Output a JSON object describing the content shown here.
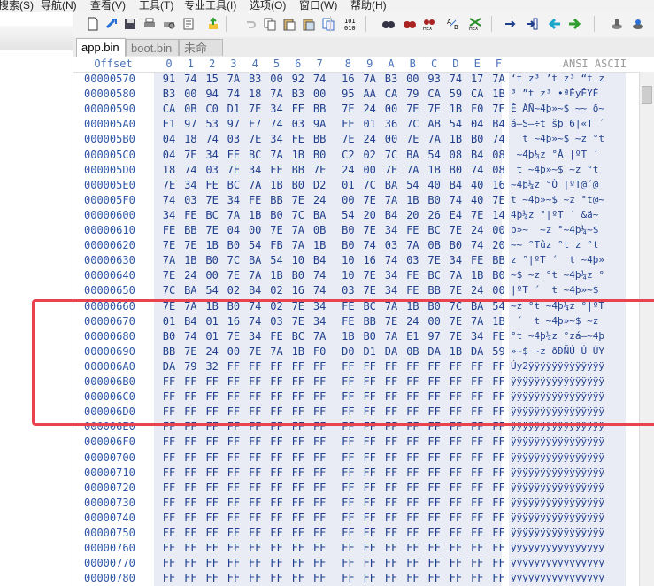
{
  "menu": [
    "搜索(S)",
    "导航(N)",
    "查看(V)",
    "工具(T)",
    "专业工具(I)",
    "选项(O)",
    "窗口(W)",
    "帮助(H)"
  ],
  "toolbar_icons": [
    "new-file-icon",
    "open-file-icon",
    "save-icon",
    "print-icon",
    "print-preview-icon",
    "properties-icon",
    "upload-icon",
    "undo-icon",
    "copy-icon",
    "paste-icon",
    "paste-special-icon",
    "copy-format-icon",
    "binary-icon",
    "find-icon",
    "find-next-icon",
    "find-hex-icon",
    "replace-icon",
    "replace-hex-icon",
    "goto-icon",
    "goto-offset-icon",
    "back-icon",
    "forward-icon",
    "tools-icon",
    "settings-icon"
  ],
  "tabs": [
    {
      "label": "app.bin",
      "active": true
    },
    {
      "label": "boot.bin",
      "active": false
    },
    {
      "label": "未命名",
      "active": false
    }
  ],
  "header": {
    "offset_label": "Offset",
    "columns": [
      "0",
      "1",
      "2",
      "3",
      "4",
      "5",
      "6",
      "7",
      "8",
      "9",
      "A",
      "B",
      "C",
      "D",
      "E",
      "F"
    ],
    "ansi_label": "ANSI ASCII"
  },
  "rows": [
    {
      "offset": "00000570",
      "bytes": [
        "91",
        "74",
        "15",
        "7A",
        "B3",
        "00",
        "92",
        "74",
        "16",
        "7A",
        "B3",
        "00",
        "93",
        "74",
        "17",
        "7A"
      ],
      "ansi": "‘t z³ ’t z³ “t z"
    },
    {
      "offset": "00000580",
      "bytes": [
        "B3",
        "00",
        "94",
        "74",
        "18",
        "7A",
        "B3",
        "00",
        "95",
        "AA",
        "CA",
        "79",
        "CA",
        "59",
        "CA",
        "1B"
      ],
      "ansi": "³ ”t z³ •ªÊyÊYÊ"
    },
    {
      "offset": "00000590",
      "bytes": [
        "CA",
        "0B",
        "C0",
        "D1",
        "7E",
        "34",
        "FE",
        "BB",
        "7E",
        "24",
        "00",
        "7E",
        "7E",
        "1B",
        "F0",
        "7E"
      ],
      "ansi": "Ê ÀÑ~4þ»~$ ~~ ð~"
    },
    {
      "offset": "000005A0",
      "bytes": [
        "E1",
        "97",
        "53",
        "97",
        "F7",
        "74",
        "03",
        "9A",
        "FE",
        "01",
        "36",
        "7C",
        "AB",
        "54",
        "04",
        "B4"
      ],
      "ansi": "á—S—÷t šþ 6|«T ´"
    },
    {
      "offset": "000005B0",
      "bytes": [
        "04",
        "18",
        "74",
        "03",
        "7E",
        "34",
        "FE",
        "BB",
        "7E",
        "24",
        "00",
        "7E",
        "7A",
        "1B",
        "B0",
        "74"
      ],
      "ansi": "  t ~4þ»~$ ~z °t"
    },
    {
      "offset": "000005C0",
      "bytes": [
        "04",
        "7E",
        "34",
        "FE",
        "BC",
        "7A",
        "1B",
        "B0",
        "C2",
        "02",
        "7C",
        "BA",
        "54",
        "08",
        "B4",
        "08"
      ],
      "ansi": " ~4þ¼z °Â |ºT ´ "
    },
    {
      "offset": "000005D0",
      "bytes": [
        "18",
        "74",
        "03",
        "7E",
        "34",
        "FE",
        "BB",
        "7E",
        "24",
        "00",
        "7E",
        "7A",
        "1B",
        "B0",
        "74",
        "08"
      ],
      "ansi": " t ~4þ»~$ ~z °t "
    },
    {
      "offset": "000005E0",
      "bytes": [
        "7E",
        "34",
        "FE",
        "BC",
        "7A",
        "1B",
        "B0",
        "D2",
        "01",
        "7C",
        "BA",
        "54",
        "40",
        "B4",
        "40",
        "16"
      ],
      "ansi": "~4þ¼z °Ò |ºT@´@ "
    },
    {
      "offset": "000005F0",
      "bytes": [
        "74",
        "03",
        "7E",
        "34",
        "FE",
        "BB",
        "7E",
        "24",
        "00",
        "7E",
        "7A",
        "1B",
        "B0",
        "74",
        "40",
        "7E"
      ],
      "ansi": "t ~4þ»~$ ~z °t@~"
    },
    {
      "offset": "00000600",
      "bytes": [
        "34",
        "FE",
        "BC",
        "7A",
        "1B",
        "B0",
        "7C",
        "BA",
        "54",
        "20",
        "B4",
        "20",
        "26",
        "E4",
        "7E",
        "14"
      ],
      "ansi": "4þ¼z °|ºT ´ &ä~ "
    },
    {
      "offset": "00000610",
      "bytes": [
        "FE",
        "BB",
        "7E",
        "04",
        "00",
        "7E",
        "7A",
        "0B",
        "B0",
        "7E",
        "34",
        "FE",
        "BC",
        "7E",
        "24",
        "00"
      ],
      "ansi": "þ»~  ~z °~4þ¼~$ "
    },
    {
      "offset": "00000620",
      "bytes": [
        "7E",
        "7E",
        "1B",
        "B0",
        "54",
        "FB",
        "7A",
        "1B",
        "B0",
        "74",
        "03",
        "7A",
        "0B",
        "B0",
        "74",
        "20"
      ],
      "ansi": "~~ °Tûz °t z °t "
    },
    {
      "offset": "00000630",
      "bytes": [
        "7A",
        "1B",
        "B0",
        "7C",
        "BA",
        "54",
        "10",
        "B4",
        "10",
        "16",
        "74",
        "03",
        "7E",
        "34",
        "FE",
        "BB"
      ],
      "ansi": "z °|ºT ´  t ~4þ»"
    },
    {
      "offset": "00000640",
      "bytes": [
        "7E",
        "24",
        "00",
        "7E",
        "7A",
        "1B",
        "B0",
        "74",
        "10",
        "7E",
        "34",
        "FE",
        "BC",
        "7A",
        "1B",
        "B0"
      ],
      "ansi": "~$ ~z °t ~4þ¼z °"
    },
    {
      "offset": "00000650",
      "bytes": [
        "7C",
        "BA",
        "54",
        "02",
        "B4",
        "02",
        "16",
        "74",
        "03",
        "7E",
        "34",
        "FE",
        "BB",
        "7E",
        "24",
        "00"
      ],
      "ansi": "|ºT ´  t ~4þ»~$ "
    },
    {
      "offset": "00000660",
      "bytes": [
        "7E",
        "7A",
        "1B",
        "B0",
        "74",
        "02",
        "7E",
        "34",
        "FE",
        "BC",
        "7A",
        "1B",
        "B0",
        "7C",
        "BA",
        "54"
      ],
      "ansi": "~z °t ~4þ¼z °|ºT"
    },
    {
      "offset": "00000670",
      "bytes": [
        "01",
        "B4",
        "01",
        "16",
        "74",
        "03",
        "7E",
        "34",
        "FE",
        "BB",
        "7E",
        "24",
        "00",
        "7E",
        "7A",
        "1B"
      ],
      "ansi": " ´  t ~4þ»~$ ~z "
    },
    {
      "offset": "00000680",
      "bytes": [
        "B0",
        "74",
        "01",
        "7E",
        "34",
        "FE",
        "BC",
        "7A",
        "1B",
        "B0",
        "7A",
        "E1",
        "97",
        "7E",
        "34",
        "FE"
      ],
      "ansi": "°t ~4þ¼z °zá—~4þ"
    },
    {
      "offset": "00000690",
      "bytes": [
        "BB",
        "7E",
        "24",
        "00",
        "7E",
        "7A",
        "1B",
        "F0",
        "D0",
        "D1",
        "DA",
        "0B",
        "DA",
        "1B",
        "DA",
        "59"
      ],
      "ansi": "»~$ ~z ðÐÑÚ Ú ÚY"
    },
    {
      "offset": "000006A0",
      "bytes": [
        "DA",
        "79",
        "32",
        "FF",
        "FF",
        "FF",
        "FF",
        "FF",
        "FF",
        "FF",
        "FF",
        "FF",
        "FF",
        "FF",
        "FF",
        "FF"
      ],
      "ansi": "Úy2ÿÿÿÿÿÿÿÿÿÿÿÿÿ"
    },
    {
      "offset": "000006B0",
      "bytes": [
        "FF",
        "FF",
        "FF",
        "FF",
        "FF",
        "FF",
        "FF",
        "FF",
        "FF",
        "FF",
        "FF",
        "FF",
        "FF",
        "FF",
        "FF",
        "FF"
      ],
      "ansi": "ÿÿÿÿÿÿÿÿÿÿÿÿÿÿÿÿ"
    },
    {
      "offset": "000006C0",
      "bytes": [
        "FF",
        "FF",
        "FF",
        "FF",
        "FF",
        "FF",
        "FF",
        "FF",
        "FF",
        "FF",
        "FF",
        "FF",
        "FF",
        "FF",
        "FF",
        "FF"
      ],
      "ansi": "ÿÿÿÿÿÿÿÿÿÿÿÿÿÿÿÿ"
    },
    {
      "offset": "000006D0",
      "bytes": [
        "FF",
        "FF",
        "FF",
        "FF",
        "FF",
        "FF",
        "FF",
        "FF",
        "FF",
        "FF",
        "FF",
        "FF",
        "FF",
        "FF",
        "FF",
        "FF"
      ],
      "ansi": "ÿÿÿÿÿÿÿÿÿÿÿÿÿÿÿÿ"
    },
    {
      "offset": "000006E0",
      "bytes": [
        "FF",
        "FF",
        "FF",
        "FF",
        "FF",
        "FF",
        "FF",
        "FF",
        "FF",
        "FF",
        "FF",
        "FF",
        "FF",
        "FF",
        "FF",
        "FF"
      ],
      "ansi": "ÿÿÿÿÿÿÿÿÿÿÿÿÿÿÿÿ"
    },
    {
      "offset": "000006F0",
      "bytes": [
        "FF",
        "FF",
        "FF",
        "FF",
        "FF",
        "FF",
        "FF",
        "FF",
        "FF",
        "FF",
        "FF",
        "FF",
        "FF",
        "FF",
        "FF",
        "FF"
      ],
      "ansi": "ÿÿÿÿÿÿÿÿÿÿÿÿÿÿÿÿ"
    },
    {
      "offset": "00000700",
      "bytes": [
        "FF",
        "FF",
        "FF",
        "FF",
        "FF",
        "FF",
        "FF",
        "FF",
        "FF",
        "FF",
        "FF",
        "FF",
        "FF",
        "FF",
        "FF",
        "FF"
      ],
      "ansi": "ÿÿÿÿÿÿÿÿÿÿÿÿÿÿÿÿ"
    },
    {
      "offset": "00000710",
      "bytes": [
        "FF",
        "FF",
        "FF",
        "FF",
        "FF",
        "FF",
        "FF",
        "FF",
        "FF",
        "FF",
        "FF",
        "FF",
        "FF",
        "FF",
        "FF",
        "FF"
      ],
      "ansi": "ÿÿÿÿÿÿÿÿÿÿÿÿÿÿÿÿ"
    },
    {
      "offset": "00000720",
      "bytes": [
        "FF",
        "FF",
        "FF",
        "FF",
        "FF",
        "FF",
        "FF",
        "FF",
        "FF",
        "FF",
        "FF",
        "FF",
        "FF",
        "FF",
        "FF",
        "FF"
      ],
      "ansi": "ÿÿÿÿÿÿÿÿÿÿÿÿÿÿÿÿ"
    },
    {
      "offset": "00000730",
      "bytes": [
        "FF",
        "FF",
        "FF",
        "FF",
        "FF",
        "FF",
        "FF",
        "FF",
        "FF",
        "FF",
        "FF",
        "FF",
        "FF",
        "FF",
        "FF",
        "FF"
      ],
      "ansi": "ÿÿÿÿÿÿÿÿÿÿÿÿÿÿÿÿ"
    },
    {
      "offset": "00000740",
      "bytes": [
        "FF",
        "FF",
        "FF",
        "FF",
        "FF",
        "FF",
        "FF",
        "FF",
        "FF",
        "FF",
        "FF",
        "FF",
        "FF",
        "FF",
        "FF",
        "FF"
      ],
      "ansi": "ÿÿÿÿÿÿÿÿÿÿÿÿÿÿÿÿ"
    },
    {
      "offset": "00000750",
      "bytes": [
        "FF",
        "FF",
        "FF",
        "FF",
        "FF",
        "FF",
        "FF",
        "FF",
        "FF",
        "FF",
        "FF",
        "FF",
        "FF",
        "FF",
        "FF",
        "FF"
      ],
      "ansi": "ÿÿÿÿÿÿÿÿÿÿÿÿÿÿÿÿ"
    },
    {
      "offset": "00000760",
      "bytes": [
        "FF",
        "FF",
        "FF",
        "FF",
        "FF",
        "FF",
        "FF",
        "FF",
        "FF",
        "FF",
        "FF",
        "FF",
        "FF",
        "FF",
        "FF",
        "FF"
      ],
      "ansi": "ÿÿÿÿÿÿÿÿÿÿÿÿÿÿÿÿ"
    },
    {
      "offset": "00000770",
      "bytes": [
        "FF",
        "FF",
        "FF",
        "FF",
        "FF",
        "FF",
        "FF",
        "FF",
        "FF",
        "FF",
        "FF",
        "FF",
        "FF",
        "FF",
        "FF",
        "FF"
      ],
      "ansi": "ÿÿÿÿÿÿÿÿÿÿÿÿÿÿÿÿ"
    },
    {
      "offset": "00000780",
      "bytes": [
        "FF",
        "FF",
        "FF",
        "FF",
        "FF",
        "FF",
        "FF",
        "FF",
        "FF",
        "FF",
        "FF",
        "FF",
        "FF",
        "FF",
        "FF",
        "FF"
      ],
      "ansi": "ÿÿÿÿÿÿÿÿÿÿÿÿÿÿÿÿ"
    }
  ],
  "colors": {
    "highlight_box": "#e8434f",
    "hex_text": "#1f3f8c",
    "offset_text": "#2d55a6",
    "data_background": "#e9ecf5"
  }
}
